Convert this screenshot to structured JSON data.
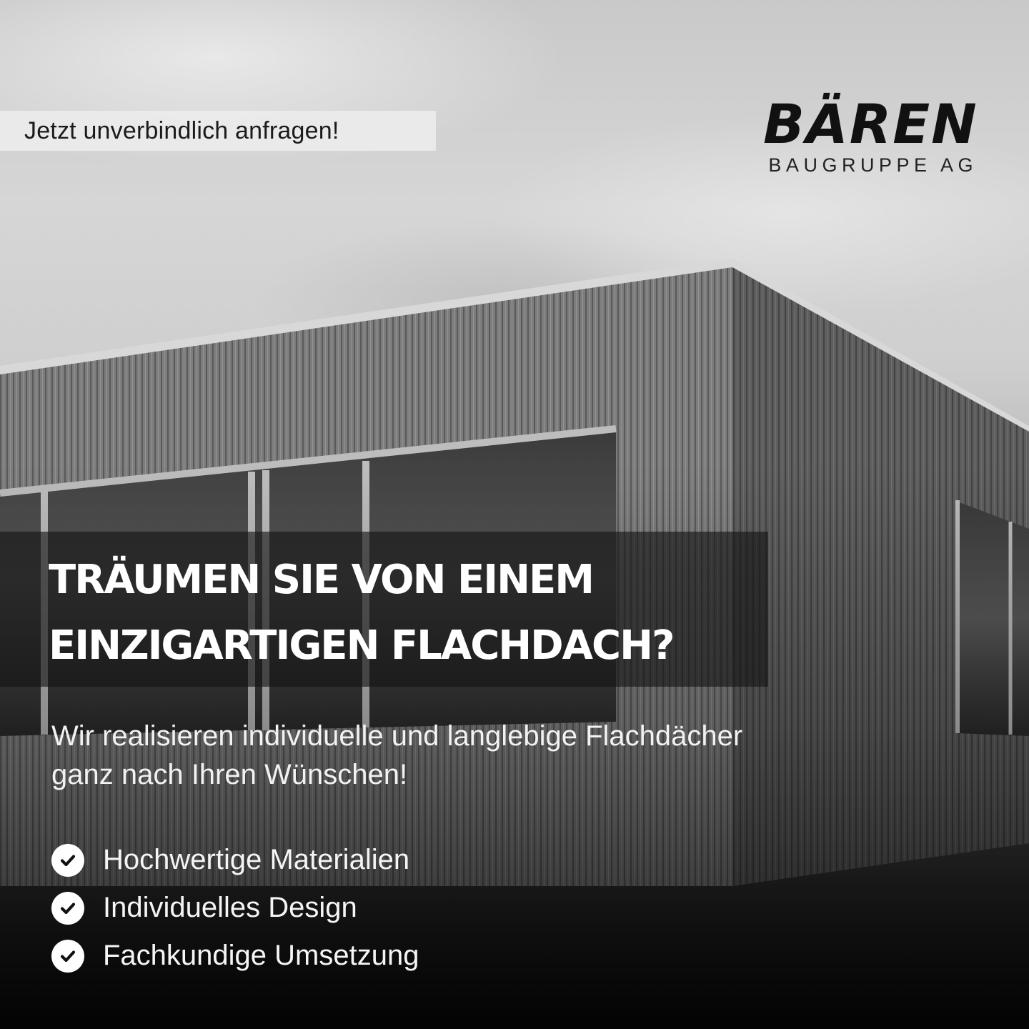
{
  "cta": {
    "label": "Jetzt unverbindlich anfragen!"
  },
  "logo": {
    "name": "BÄREN",
    "subtitle": "BAUGRUPPE AG"
  },
  "headline": {
    "line1": "TRÄUMEN SIE VON EINEM",
    "line2": "EINZIGARTIGEN FLACHDACH?"
  },
  "subline": {
    "line1": "Wir realisieren individuelle und langlebige Flachdächer",
    "line2": "ganz nach Ihren Wünschen!"
  },
  "features": [
    {
      "label": "Hochwertige Materialien",
      "icon": "check-circle-icon"
    },
    {
      "label": "Individuelles Design",
      "icon": "check-circle-icon"
    },
    {
      "label": "Fachkundige Umsetzung",
      "icon": "check-circle-icon"
    }
  ],
  "colors": {
    "text_light": "#ffffff",
    "text_dark": "#111111",
    "band": "#141414"
  }
}
